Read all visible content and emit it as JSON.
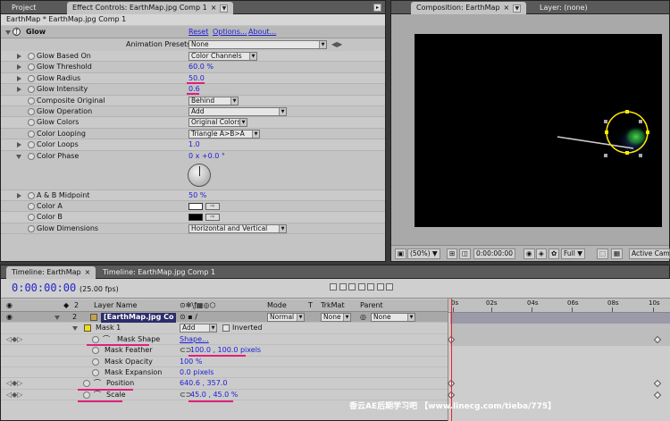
{
  "effect_controls": {
    "tabs": [
      "Project",
      "Effect Controls: EarthMap.jpg Comp 1"
    ],
    "header": "EarthMap * EarthMap.jpg Comp 1",
    "effect_name": "Glow",
    "reset": "Reset",
    "options": "Options...",
    "about": "About...",
    "presets_label": "Animation Presets:",
    "presets_value": "None",
    "properties": [
      {
        "name": "Glow Based On",
        "value": "Color Channels"
      },
      {
        "name": "Glow Threshold",
        "value": "60.0 %"
      },
      {
        "name": "Glow Radius",
        "value": "50.0"
      },
      {
        "name": "Glow Intensity",
        "value": "0.6"
      },
      {
        "name": "Composite Original",
        "value": "Behind"
      },
      {
        "name": "Glow Operation",
        "value": "Add"
      },
      {
        "name": "Glow Colors",
        "value": "Original Colors"
      },
      {
        "name": "Color Looping",
        "value": "Triangle A>B>A"
      },
      {
        "name": "Color Loops",
        "value": "1.0"
      },
      {
        "name": "Color Phase",
        "value": "0 x +0.0 °"
      },
      {
        "name": "A & B Midpoint",
        "value": "50 %"
      },
      {
        "name": "Color A",
        "value": ""
      },
      {
        "name": "Color B",
        "value": ""
      },
      {
        "name": "Glow Dimensions",
        "value": "Horizontal and Vertical"
      }
    ]
  },
  "composition": {
    "tab": "Composition: EarthMap",
    "layer_tab": "Layer: (none)",
    "zoom": "(50%)",
    "timecode": "0:00:00:00",
    "resolution": "Full",
    "camera": "Active Came"
  },
  "timeline": {
    "tabs": [
      "Timeline: EarthMap",
      "Timeline: EarthMap.jpg Comp 1"
    ],
    "timecode": "0:00:00:00",
    "fps": "(25.00 fps)",
    "headers": {
      "layer_name": "Layer Name",
      "mode": "Mode",
      "t": "T",
      "trkmat": "TrkMat",
      "parent": "Parent"
    },
    "ruler": [
      "0s",
      "02s",
      "04s",
      "06s",
      "08s",
      "10s"
    ],
    "layer": {
      "num": "2",
      "name": "[EarthMap.jpg Co",
      "mode": "Normal",
      "trkmat": "None",
      "parent": "None"
    },
    "mask": {
      "name": "Mask 1",
      "mode": "Add",
      "inverted": "Inverted"
    },
    "props": [
      {
        "name": "Mask Shape",
        "value": "Shape..."
      },
      {
        "name": "Mask Feather",
        "value": "100.0 , 100.0 pixels"
      },
      {
        "name": "Mask Opacity",
        "value": "100 %"
      },
      {
        "name": "Mask Expansion",
        "value": "0.0 pixels"
      },
      {
        "name": "Position",
        "value": "640.6 , 357.0"
      },
      {
        "name": "Scale",
        "value": "45.0 , 45.0 %"
      }
    ],
    "watermark": "香云AE后期学习吧 【www.linecg.com/tieba/775】"
  }
}
